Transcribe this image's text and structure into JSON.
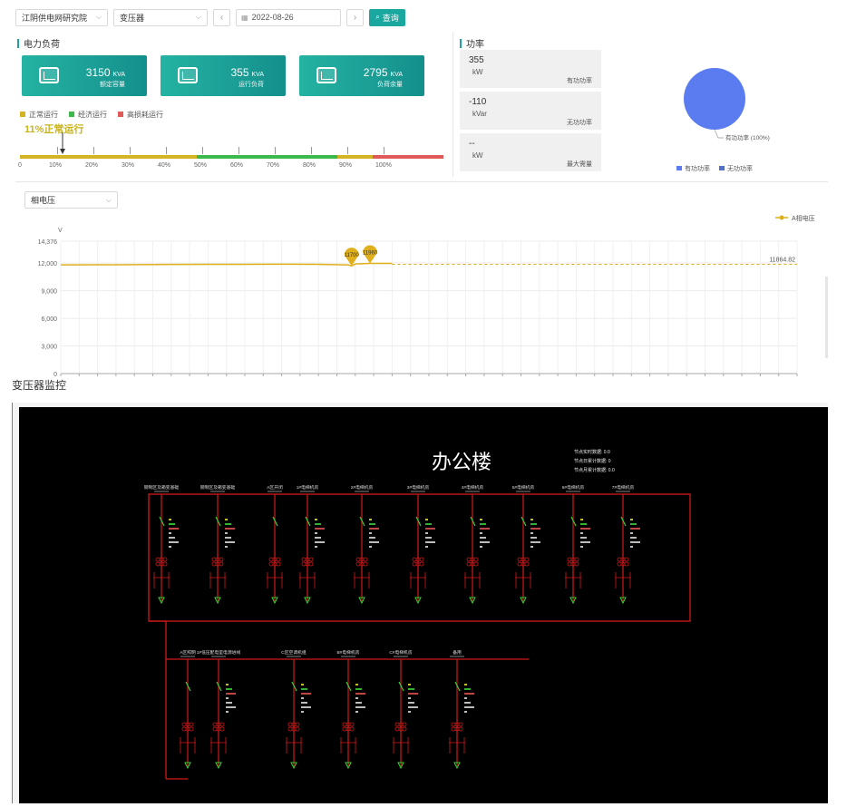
{
  "toolbar": {
    "org_select": "江阴供电网研究院",
    "device_select": "变压器",
    "date": "2022-08-26",
    "query_label": "查询"
  },
  "load": {
    "title": "电力负荷",
    "cards": [
      {
        "value": "3150",
        "unit": "KVA",
        "label": "额定容量"
      },
      {
        "value": "355",
        "unit": "KVA",
        "label": "运行负荷"
      },
      {
        "value": "2795",
        "unit": "KVA",
        "label": "负荷余量"
      }
    ],
    "legend": [
      {
        "label": "正常运行",
        "color": "#d4b425"
      },
      {
        "label": "经济运行",
        "color": "#3db84a"
      },
      {
        "label": "高损耗运行",
        "color": "#e05a5a"
      }
    ],
    "status_text": "11%正常运行",
    "load_fraction": 0.11,
    "scale_labels": [
      "0",
      "10%",
      "20%",
      "30%",
      "40%",
      "50%",
      "60%",
      "70%",
      "80%",
      "90%",
      "100%"
    ]
  },
  "power": {
    "title": "功率",
    "boxes": [
      {
        "value": "355",
        "unit": "kW",
        "name": "有功功率"
      },
      {
        "value": "-110",
        "unit": "kVar",
        "name": "无功功率"
      },
      {
        "value": "--",
        "unit": "kW",
        "name": "最大需量"
      }
    ],
    "pie_label": "有功功率 (100%)",
    "pie_legend": [
      "有功功率",
      "无功功率"
    ],
    "pie_colors": [
      "#5b7cf0",
      "#5470c6"
    ]
  },
  "voltage": {
    "select": "相电压",
    "legend": "A相电压",
    "line_color": "#e0b01c"
  },
  "monitor": {
    "section_label": "变压器监控",
    "building": "办公楼",
    "stats": [
      "节点实时数据: 0.0",
      "节点日累计数据: 0",
      "节点月累计数据: 0.0"
    ],
    "top_feeders": [
      "钢制区及箱变基础",
      "钢制区及箱变基础",
      "A区开闭",
      "1#电梯机房",
      "2#电梯机房",
      "3#电梯机房",
      "4#电梯机房",
      "5#电梯机房",
      "6#电梯机房",
      "7#电梯机房"
    ],
    "bottom_feeders": [
      "A区照明",
      "1#低压配电室电源进线",
      "C区空调机组",
      "B#电梯机房",
      "C#电梯机房",
      "备用"
    ]
  },
  "chart_data": {
    "type": "line",
    "title": "",
    "xlabel": "",
    "ylabel": "V",
    "ylim": [
      0,
      14376
    ],
    "yticks": [
      "0",
      "3,000",
      "6,000",
      "9,000",
      "12,000",
      "14,376"
    ],
    "grid": true,
    "legend_position": "top-right",
    "series": [
      {
        "name": "A相电压",
        "x": [
          0,
          0.05,
          0.1,
          0.15,
          0.2,
          0.25,
          0.3,
          0.35,
          0.39,
          0.395,
          0.4,
          0.42,
          0.45
        ],
        "values": [
          11800,
          11810,
          11830,
          11850,
          11860,
          11870,
          11880,
          11860,
          11800,
          11700,
          11900,
          11960,
          11960
        ]
      }
    ],
    "annotations": [
      {
        "label": "11700",
        "type": "min-marker",
        "y": 11700
      },
      {
        "label": "11960",
        "type": "max-marker",
        "y": 11960
      },
      {
        "label": "11864.82",
        "type": "average-line",
        "y": 11864.82
      }
    ]
  }
}
